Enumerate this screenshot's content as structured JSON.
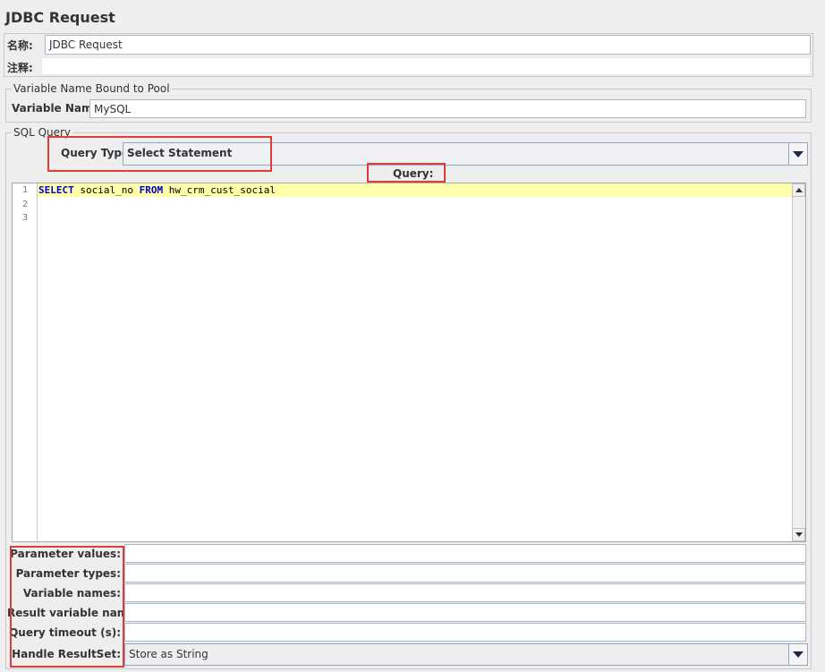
{
  "header": {
    "title": "JDBC Request"
  },
  "name_field": {
    "label": "名称:",
    "value": "JDBC Request"
  },
  "comment_field": {
    "label": "注释:",
    "value": ""
  },
  "pool_group": {
    "title": "Variable Name Bound to Pool",
    "label": "Variable Name:",
    "value": "MySQL"
  },
  "sql_group": {
    "title": "SQL Query",
    "query_type_label": "Query Type:",
    "query_type_value": "Select Statement",
    "query_label": "Query:",
    "lines": [
      "1",
      "2",
      "3"
    ],
    "code": {
      "kw1": "SELECT",
      "t1": " social_no ",
      "kw2": "FROM",
      "t2": " hw_crm_cust_social"
    }
  },
  "params": {
    "parameter_values": {
      "label": "Parameter values:",
      "value": ""
    },
    "parameter_types": {
      "label": "Parameter types:",
      "value": ""
    },
    "variable_names": {
      "label": "Variable names:",
      "value": ""
    },
    "result_variable_name": {
      "label": "Result variable name:",
      "value": ""
    },
    "query_timeout": {
      "label": "Query timeout (s):",
      "value": ""
    },
    "handle_resultset": {
      "label": "Handle ResultSet:",
      "value": "Store as String"
    }
  },
  "icons": {
    "dropdown": "chevron-down-icon",
    "scroll_up": "arrow-up-icon",
    "scroll_down": "arrow-down-icon"
  },
  "colors": {
    "highlight": "#e03c3c",
    "current_line": "#ffffaa",
    "keyword": "#0000c8"
  }
}
